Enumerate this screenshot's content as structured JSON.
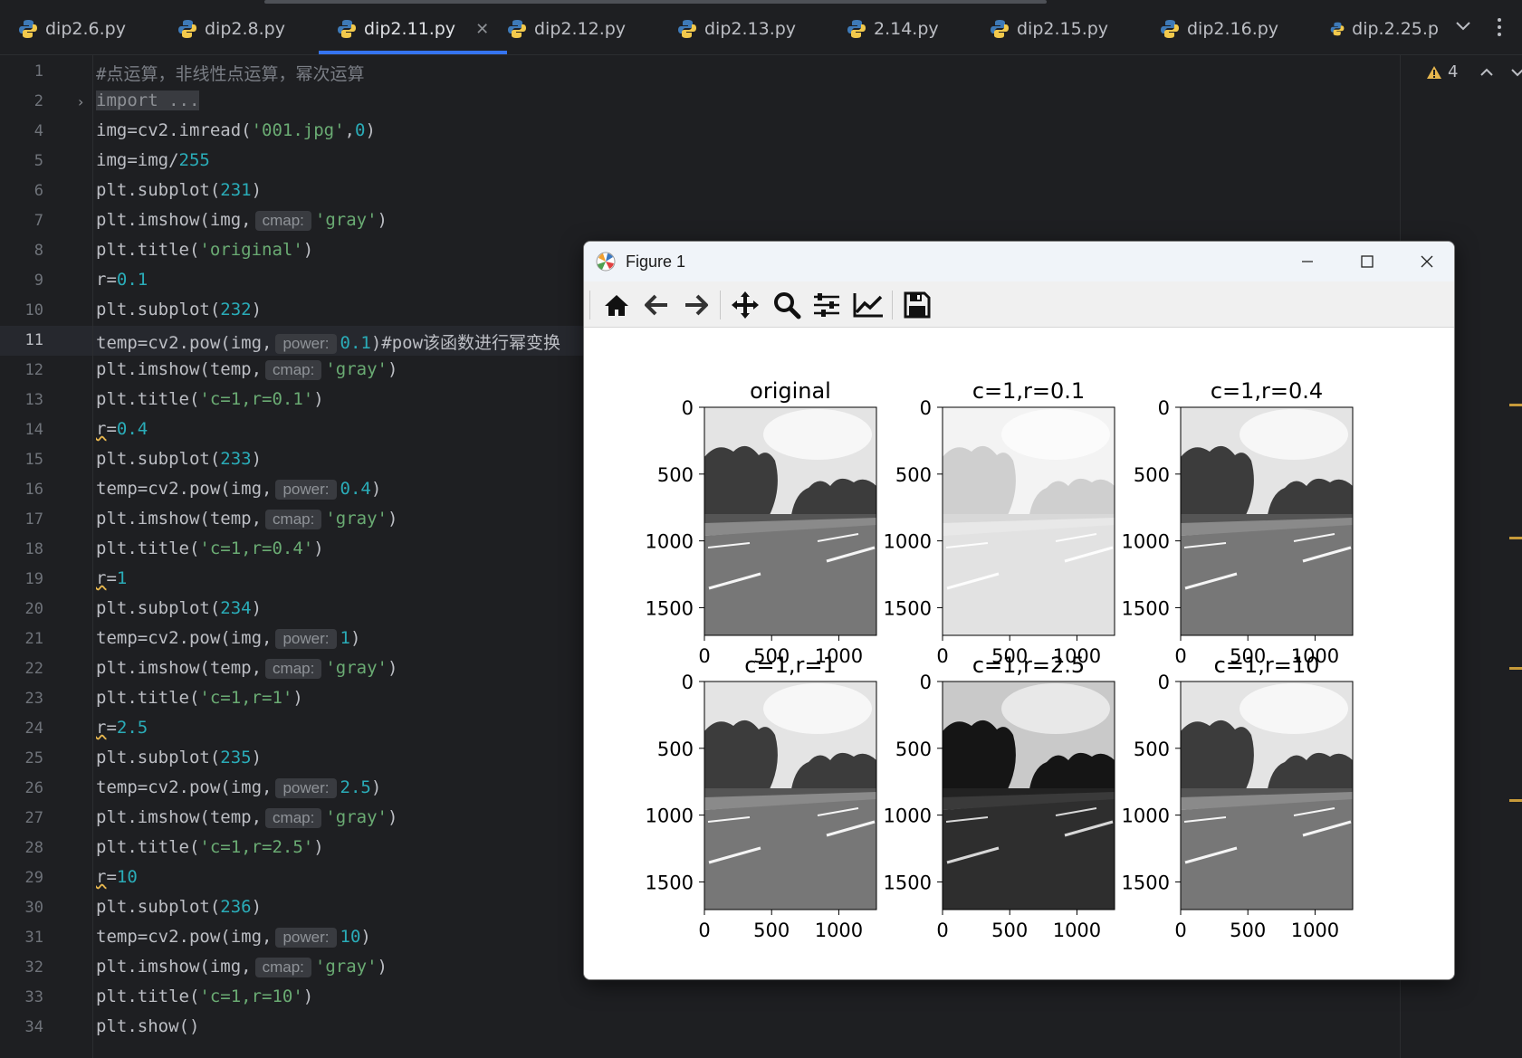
{
  "tabs": [
    {
      "label": "dip2.6.py",
      "active": false
    },
    {
      "label": "dip2.8.py",
      "active": false
    },
    {
      "label": "dip2.11.py",
      "active": true
    },
    {
      "label": "dip2.12.py",
      "active": false
    },
    {
      "label": "dip2.13.py",
      "active": false
    },
    {
      "label": "2.14.py",
      "active": false
    },
    {
      "label": "dip2.15.py",
      "active": false
    },
    {
      "label": "dip2.16.py",
      "active": false
    },
    {
      "label": "dip.2.25.p",
      "active": false
    }
  ],
  "inspection": {
    "warning_count": "4"
  },
  "editor": {
    "current_line": "11",
    "line_numbers": [
      "1",
      "2",
      "4",
      "5",
      "6",
      "7",
      "8",
      "9",
      "10",
      "11",
      "12",
      "13",
      "14",
      "15",
      "16",
      "17",
      "18",
      "19",
      "20",
      "21",
      "22",
      "23",
      "24",
      "25",
      "26",
      "27",
      "28",
      "29",
      "30",
      "31",
      "32",
      "33",
      "34"
    ],
    "lines": {
      "l1": "#点运算，非线性点运算，幂次运算",
      "l2": "import ...",
      "l4_a": "img=cv2.imread(",
      "l4_s": "'001.jpg'",
      "l4_b": ",",
      "l4_n": "0",
      "l4_c": ")",
      "l5_a": "img=img/",
      "l5_n": "255",
      "sub": "plt.subplot(",
      "close": ")",
      "l6_n": "231",
      "imshow_img": "plt.imshow(img,",
      "imshow_temp": "plt.imshow(temp,",
      "cmap_hint": "cmap:",
      "gray": "'gray'",
      "title": "plt.title(",
      "t_orig": "'original'",
      "l9_a": "r=",
      "l9_n": "0.1",
      "l10_n": "232",
      "pow": "temp=cv2.pow(img,",
      "power_hint": "power:",
      "l11_n": "0.1",
      "l11_c": ")#pow该函数进行幂变换",
      "t_01": "'c=1,r=0.1'",
      "l14_r": "r",
      "l14_eq": "=",
      "l14_n": "0.4",
      "l15_n": "233",
      "l16_n": "0.4",
      "t_04": "'c=1,r=0.4'",
      "l19_n": "1",
      "l20_n": "234",
      "l21_n": "1",
      "t_1": "'c=1,r=1'",
      "l24_n": "2.5",
      "l25_n": "235",
      "l26_n": "2.5",
      "t_25": "'c=1,r=2.5'",
      "l29_n": "10",
      "l30_n": "236",
      "l31_n": "10",
      "t_10": "'c=1,r=10'",
      "l34": "plt.show()"
    }
  },
  "figure": {
    "window_title": "Figure 1",
    "toolbar": [
      "home-icon",
      "back-icon",
      "forward-icon",
      "pan-icon",
      "zoom-icon",
      "configure-subplots-icon",
      "edit-axes-icon",
      "save-icon"
    ]
  },
  "chart_data": {
    "type": "image-grid",
    "subplots": [
      {
        "title": "original",
        "brightness": "normal",
        "yticks": [
          "0",
          "500",
          "1000",
          "1500"
        ],
        "xticks": [
          "0",
          "500",
          "1000"
        ]
      },
      {
        "title": "c=1,r=0.1",
        "brightness": "very-light",
        "yticks": [
          "0",
          "500",
          "1000",
          "1500"
        ],
        "xticks": [
          "0",
          "500",
          "1000"
        ]
      },
      {
        "title": "c=1,r=0.4",
        "brightness": "normal",
        "yticks": [
          "0",
          "500",
          "1000",
          "1500"
        ],
        "xticks": [
          "0",
          "500",
          "1000"
        ]
      },
      {
        "title": "c=1,r=1",
        "brightness": "normal",
        "yticks": [
          "0",
          "500",
          "1000",
          "1500"
        ],
        "xticks": [
          "0",
          "500",
          "1000"
        ]
      },
      {
        "title": "c=1,r=2.5",
        "brightness": "dark",
        "yticks": [
          "0",
          "500",
          "1000",
          "1500"
        ],
        "xticks": [
          "0",
          "500",
          "1000"
        ]
      },
      {
        "title": "c=1,r=10",
        "brightness": "normal",
        "yticks": [
          "0",
          "500",
          "1000",
          "1500"
        ],
        "xticks": [
          "0",
          "500",
          "1000"
        ]
      }
    ],
    "xlim": [
      0,
      1280
    ],
    "ylim": [
      1707,
      0
    ],
    "colors": {
      "sky": "#e6e6e6",
      "trees": "#3a3a3a",
      "road": "#6e6e6e"
    }
  }
}
